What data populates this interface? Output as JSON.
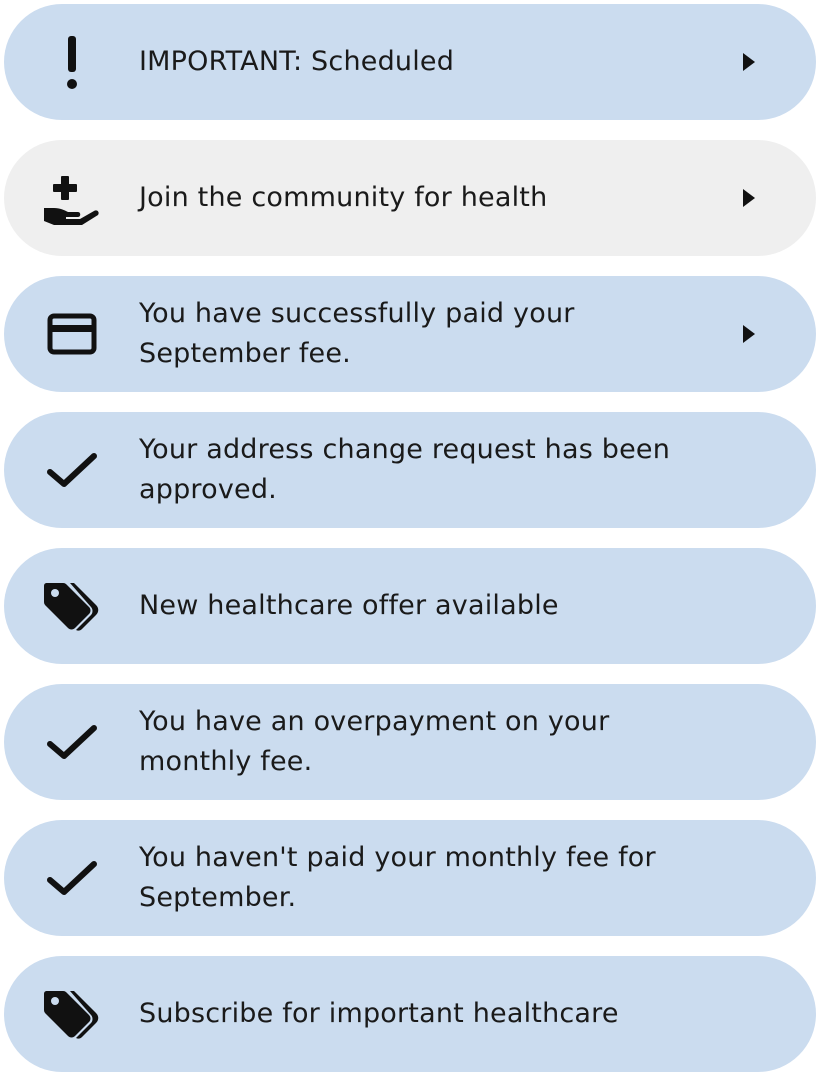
{
  "notifications": [
    {
      "label": "IMPORTANT: Scheduled",
      "icon": "exclamation-icon",
      "style": "blue",
      "chevron": true
    },
    {
      "label": "Join the community for health",
      "icon": "hand-plus-icon",
      "style": "gray",
      "chevron": true
    },
    {
      "label": "You have successfully paid your September fee.",
      "icon": "credit-card-icon",
      "style": "blue",
      "chevron": true
    },
    {
      "label": "Your address change request has been approved.",
      "icon": "checkmark-icon",
      "style": "blue",
      "chevron": false
    },
    {
      "label": "New healthcare offer available",
      "icon": "tags-icon",
      "style": "blue",
      "chevron": false
    },
    {
      "label": "You have an overpayment on your monthly fee.",
      "icon": "checkmark-icon",
      "style": "blue",
      "chevron": false
    },
    {
      "label": "You haven't paid your monthly fee for September.",
      "icon": "checkmark-icon",
      "style": "blue",
      "chevron": false
    },
    {
      "label": "Subscribe for important healthcare",
      "icon": "tags-icon",
      "style": "blue",
      "chevron": false
    }
  ],
  "colors": {
    "item_blue": "#cbdcef",
    "item_gray": "#efefef",
    "icon": "#111111",
    "text": "#1a1a1a"
  }
}
